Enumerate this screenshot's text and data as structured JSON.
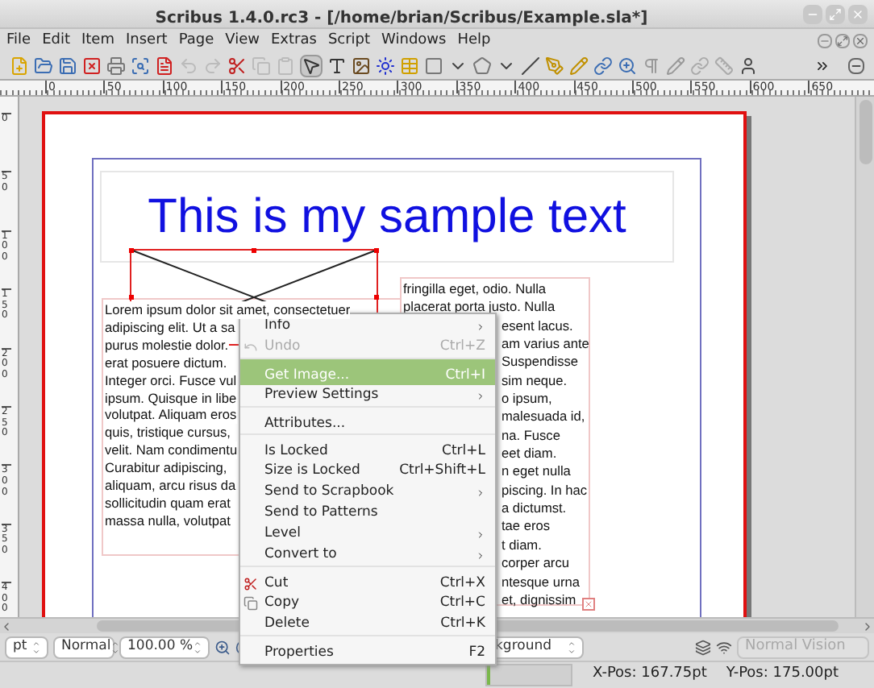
{
  "window": {
    "title": "Scribus 1.4.0.rc3 - [/home/brian/Scribus/Example.sla*]"
  },
  "menu_bar": [
    "File",
    "Edit",
    "Item",
    "Insert",
    "Page",
    "View",
    "Extras",
    "Script",
    "Windows",
    "Help"
  ],
  "horizontal_ruler": [
    "0",
    "50",
    "100",
    "150",
    "200",
    "250",
    "300",
    "350",
    "400",
    "450",
    "500",
    "550",
    "600",
    "650"
  ],
  "vertical_ruler": [
    "0",
    "50",
    "100",
    "150",
    "200",
    "250",
    "300",
    "350",
    "400"
  ],
  "page": {
    "title_text": "This is my sample text",
    "left_column": [
      "Lorem ipsum dolor sit amet, consectetuer",
      "adipiscing elit. Ut a sa",
      "purus molestie dolor.",
      "erat posuere dictum.",
      "Integer orci. Fusce vul",
      "ipsum. Quisque in libe",
      "volutpat. Aliquam eros",
      "quis, tristique cursus,",
      "velit. Nam condimentu",
      "Curabitur adipiscing,",
      "aliquam, arcu risus da",
      "sollicitudin quam erat",
      "massa nulla, volutpat"
    ],
    "right_column": [
      {
        "text": "fringilla eget, odio. Nulla",
        "kind": "full"
      },
      {
        "text": "placerat porta justo. Nulla",
        "kind": "full"
      },
      {
        "text": "esent lacus.",
        "kind": "clipped"
      },
      {
        "text": "am varius ante",
        "kind": "clipped"
      },
      {
        "text": "Suspendisse",
        "kind": "clipped"
      },
      {
        "text": "sim neque.",
        "kind": "clipped"
      },
      {
        "text": "o ipsum,",
        "kind": "clipped"
      },
      {
        "text": "malesuada id,",
        "kind": "clipped"
      },
      {
        "text": "na. Fusce",
        "kind": "clipped"
      },
      {
        "text": "eet diam.",
        "kind": "clipped"
      },
      {
        "text": "n eget nulla",
        "kind": "clipped"
      },
      {
        "text": "piscing. In hac",
        "kind": "clipped"
      },
      {
        "text": "a dictumst.",
        "kind": "clipped"
      },
      {
        "text": "tae eros",
        "kind": "clipped"
      },
      {
        "text": "t diam.",
        "kind": "clipped"
      },
      {
        "text": "corper arcu",
        "kind": "clipped"
      },
      {
        "text": "ntesque urna",
        "kind": "clipped"
      },
      {
        "text": "et, dignissim",
        "kind": "clipped"
      }
    ]
  },
  "context_menu": [
    {
      "label": "Info",
      "submenu": true,
      "disabled": false,
      "selected": false,
      "separator_before": false
    },
    {
      "label": "Undo",
      "shortcut": "Ctrl+Z",
      "submenu": false,
      "disabled": true,
      "selected": false,
      "separator_before": false
    },
    {
      "label": "Get Image...",
      "shortcut": "Ctrl+I",
      "submenu": false,
      "disabled": false,
      "selected": true,
      "separator_before": true
    },
    {
      "label": "Preview Settings",
      "submenu": true,
      "disabled": false,
      "selected": false,
      "separator_before": false
    },
    {
      "label": "Attributes...",
      "submenu": false,
      "disabled": false,
      "selected": false,
      "separator_before": true
    },
    {
      "label": "Is Locked",
      "shortcut": "Ctrl+L",
      "submenu": false,
      "disabled": false,
      "selected": false,
      "separator_before": true
    },
    {
      "label": "Size is Locked",
      "shortcut": "Ctrl+Shift+L",
      "submenu": false,
      "disabled": false,
      "selected": false,
      "separator_before": false
    },
    {
      "label": "Send to Scrapbook",
      "submenu": true,
      "disabled": false,
      "selected": false,
      "separator_before": false
    },
    {
      "label": "Send to Patterns",
      "submenu": false,
      "disabled": false,
      "selected": false,
      "separator_before": false
    },
    {
      "label": "Level",
      "submenu": true,
      "disabled": false,
      "selected": false,
      "separator_before": false
    },
    {
      "label": "Convert to",
      "submenu": true,
      "disabled": false,
      "selected": false,
      "separator_before": false
    },
    {
      "label": "Cut",
      "shortcut": "Ctrl+X",
      "submenu": false,
      "disabled": false,
      "selected": false,
      "separator_before": true
    },
    {
      "label": "Copy",
      "shortcut": "Ctrl+C",
      "submenu": false,
      "disabled": false,
      "selected": false,
      "separator_before": false
    },
    {
      "label": "Delete",
      "shortcut": "Ctrl+K",
      "submenu": false,
      "disabled": false,
      "selected": false,
      "separator_before": false
    },
    {
      "label": "Properties",
      "shortcut": "F2",
      "submenu": false,
      "disabled": false,
      "selected": false,
      "separator_before": true
    }
  ],
  "bottom_bar": {
    "unit": "pt",
    "mode": "Normal",
    "zoom": "100.00 %",
    "layer": "kground",
    "vision": {
      "label": "Normal Vision",
      "disabled": true
    }
  },
  "status_bar": {
    "progress": {
      "level": 0.03
    },
    "x_pos": "X-Pos: 167.75pt",
    "y_pos": "Y-Pos: 175.00pt"
  }
}
